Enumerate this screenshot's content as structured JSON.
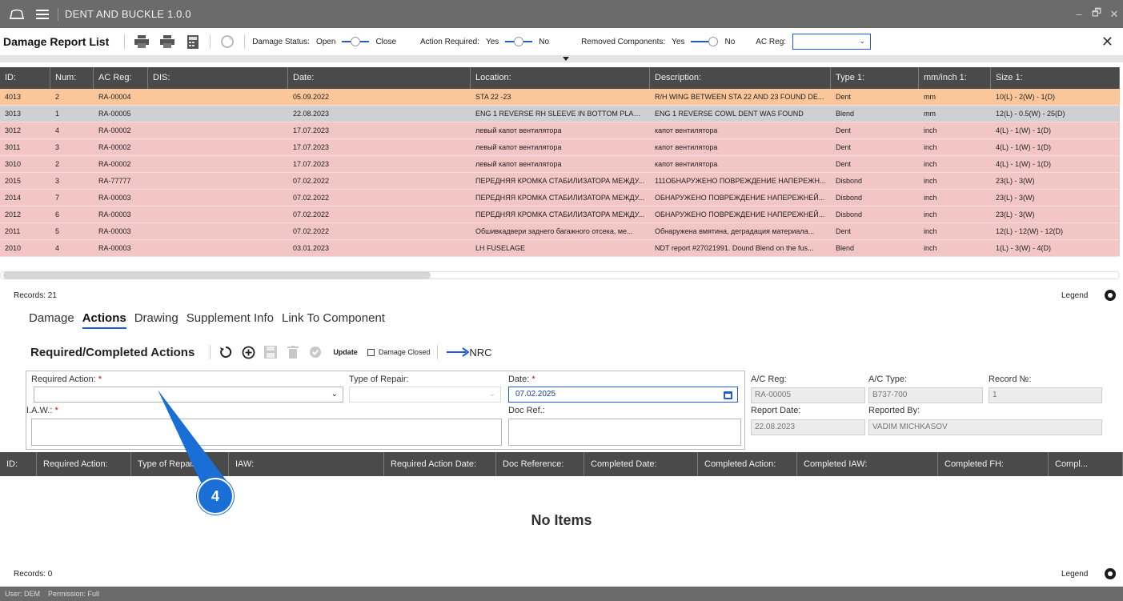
{
  "app": {
    "title": "DENT AND BUCKLE 1.0.0",
    "window_controls": [
      "–",
      "🗗",
      "✕"
    ]
  },
  "toolbar": {
    "title": "Damage Report List",
    "damage_status_label": "Damage Status:",
    "damage_status_left": "Open",
    "damage_status_right": "Close",
    "action_required_label": "Action Required:",
    "action_required_left": "Yes",
    "action_required_right": "No",
    "removed_components_label": "Removed Components:",
    "removed_components_left": "Yes",
    "removed_components_right": "No",
    "ac_reg_label": "AC Reg:",
    "ac_reg_value": ""
  },
  "grid": {
    "columns": [
      "ID:",
      "Num:",
      "AC Reg:",
      "DIS:",
      "Date:",
      "Location:",
      "Description:",
      "Type 1:",
      "mm/inch 1:",
      "Size 1:"
    ],
    "rows": [
      [
        "4013",
        "2",
        "RA-00004",
        "",
        "05.09.2022",
        "STA 22 -23",
        "R/H WING BETWEEN STA 22 AND 23 FOUND DE...",
        "Dent",
        "mm",
        "10(L) - 2(W) - 1(D)"
      ],
      [
        "3013",
        "1",
        "RA-00005",
        "",
        "22.08.2023",
        "ENG 1 REVERSE RH SLEEVE IN BOTTOM PLACE...",
        "ENG 1 REVERSE COWL DENT WAS FOUND",
        "Blend",
        "mm",
        "12(L) - 0.5(W) - 25(D)"
      ],
      [
        "3012",
        "4",
        "RA-00002",
        "",
        "17.07.2023",
        "левый капот вентилятора",
        "капот вентилятора",
        "Dent",
        "inch",
        "4(L) - 1(W) - 1(D)"
      ],
      [
        "3011",
        "3",
        "RA-00002",
        "",
        "17.07.2023",
        "левый капот вентилятора",
        "капот вентилятора",
        "Dent",
        "inch",
        "4(L) - 1(W) - 1(D)"
      ],
      [
        "3010",
        "2",
        "RA-00002",
        "",
        "17.07.2023",
        "левый капот вентилятора",
        "капот вентилятора",
        "Dent",
        "inch",
        "4(L) - 1(W) - 1(D)"
      ],
      [
        "2015",
        "3",
        "RA-77777",
        "",
        "07.02.2022",
        "ПЕРЕДНЯЯ КРОМКА СТАБИЛИЗАТОРА МЕЖДУ...",
        "111ОБНАРУЖЕНО ПОВРЕЖДЕНИЕ НАПЕРЕЖН...",
        "Disbond",
        "inch",
        "23(L) - 3(W)"
      ],
      [
        "2014",
        "7",
        "RA-00003",
        "",
        "07.02.2022",
        "ПЕРЕДНЯЯ КРОМКА СТАБИЛИЗАТОРА МЕЖДУ...",
        "ОБНАРУЖЕНО ПОВРЕЖДЕНИЕ НАПЕРЕЖНЕЙ...",
        "Disbond",
        "inch",
        "23(L) - 3(W)"
      ],
      [
        "2012",
        "6",
        "RA-00003",
        "",
        "07.02.2022",
        "ПЕРЕДНЯЯ КРОМКА СТАБИЛИЗАТОРА МЕЖДУ...",
        "ОБНАРУЖЕНО ПОВРЕЖДЕНИЕ НАПЕРЕЖНЕЙ...",
        "Disbond",
        "inch",
        "23(L) - 3(W)"
      ],
      [
        "2011",
        "5",
        "RA-00003",
        "",
        "07.02.2022",
        "Обшивкадвери заднего багажного отсека, ме...",
        "Обнаружена вмятина, деградация материала...",
        "Dent",
        "inch",
        "12(L) - 12(W) - 12(D)"
      ],
      [
        "2010",
        "4",
        "RA-00003",
        "",
        "03.01.2023",
        "LH FUSELAGE",
        "NDT report #27021991. Dound Blend on the fus...",
        "Blend",
        "inch",
        "1(L) - 3(W) - 4(D)"
      ]
    ],
    "row_colors": [
      "#fbc79a",
      "#cfcfd4",
      "#f3c6c6",
      "#f3c6c6",
      "#f3c6c6",
      "#f3c6c6",
      "#f3c6c6",
      "#f3c6c6",
      "#f3c6c6",
      "#f3c6c6"
    ],
    "records": "Records: 21",
    "legend": "Legend"
  },
  "tabs": [
    "Damage",
    "Actions",
    "Drawing",
    "Supplement Info",
    "Link To Component"
  ],
  "actions": {
    "header": "Required/Completed Actions",
    "update": "Update",
    "damage_closed": "Damage Closed",
    "nrc": "NRC"
  },
  "form": {
    "required_action_label": "Required Action:",
    "type_of_repair_label": "Type of Repair:",
    "date_label": "Date:",
    "date_value": "07.02.2025",
    "iaw_label": "I.A.W.:",
    "doc_ref_label": "Doc Ref.:",
    "ac_reg_label": "A/C Reg:",
    "ac_reg_value": "RA-00005",
    "ac_type_label": "A/C Type:",
    "ac_type_value": "B737-700",
    "record_no_label": "Record №:",
    "record_no_value": "1",
    "report_date_label": "Report Date:",
    "report_date_value": "22.08.2023",
    "reported_by_label": "Reported By:",
    "reported_by_value": "VADIM MICHKASOV",
    "required_mark": "*"
  },
  "bottom_grid": {
    "columns": [
      "ID:",
      "Required Action:",
      "Type of Repair",
      "IAW:",
      "Required Action Date:",
      "Doc Reference:",
      "Completed Date:",
      "Completed Action:",
      "Completed IAW:",
      "Completed FH:",
      "Compl..."
    ],
    "empty_text": "No Items",
    "records": "Records: 0",
    "legend": "Legend"
  },
  "status": {
    "user": "User: DEM",
    "permission": "Permission: Full"
  },
  "callout": {
    "number": "4"
  }
}
